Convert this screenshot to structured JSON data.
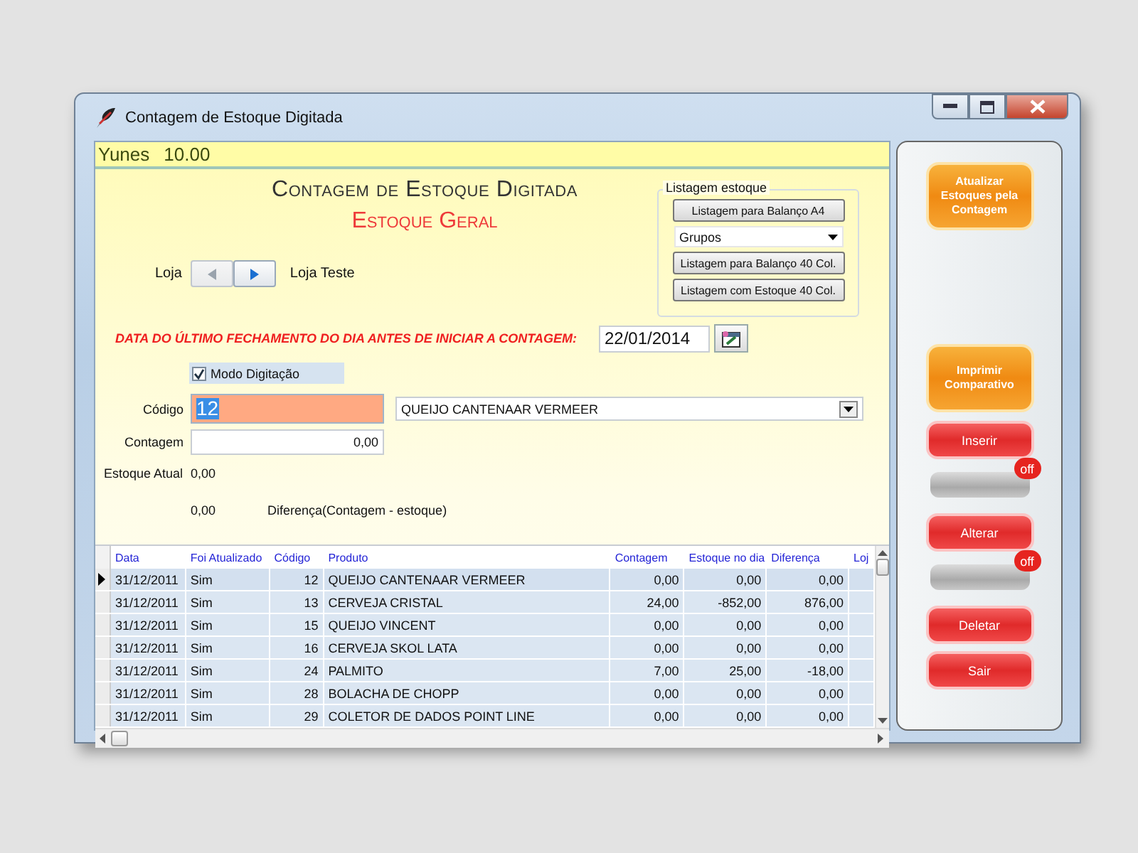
{
  "window": {
    "title": "Contagem de Estoque Digitada"
  },
  "header": {
    "user": "Yunes",
    "version": "10.00"
  },
  "form": {
    "title": "Contagem de Estoque Digitada",
    "subtitle": "Estoque Geral",
    "store": {
      "label": "Loja",
      "name": "Loja Teste",
      "nav": [
        {
          "kind": "prev",
          "disabled": true
        },
        {
          "kind": "next",
          "disabled": false
        }
      ]
    },
    "listing": {
      "title": "Listagem estoque",
      "items": [
        {
          "kind": "button",
          "label": "Listagem para Balanço A4"
        },
        {
          "kind": "select",
          "value": "Grupos"
        },
        {
          "kind": "button",
          "label": "Listagem para Balanço 40 Col."
        },
        {
          "kind": "button",
          "label": "Listagem com Estoque 40 Col."
        }
      ]
    },
    "last_close": {
      "label": "DATA DO ÚLTIMO FECHAMENTO DO DIA ANTES DE INICIAR A CONTAGEM:",
      "value": "22/01/2014"
    },
    "typing_mode": {
      "label": "Modo Digitação",
      "checked": true
    },
    "code": {
      "label": "Código",
      "value": "12",
      "product": "QUEIJO CANTENAAR VERMEER"
    },
    "count": {
      "label": "Contagem",
      "value": "0,00"
    },
    "current_stock": {
      "label": "Estoque Atual",
      "value": "0,00"
    },
    "difference": {
      "value": "0,00",
      "label": "Diferença(Contagem - estoque)"
    }
  },
  "table": {
    "columns": [
      {
        "label": "Data",
        "kind": "text"
      },
      {
        "label": "Foi Atualizado",
        "kind": "text"
      },
      {
        "label": "Código",
        "kind": "number"
      },
      {
        "label": "Produto",
        "kind": "text"
      },
      {
        "label": "Contagem",
        "kind": "number"
      },
      {
        "label": "Estoque no dia",
        "kind": "number"
      },
      {
        "label": "Diferença",
        "kind": "number"
      },
      {
        "label": "Loj",
        "kind": "text"
      }
    ],
    "rows": [
      {
        "selected": true,
        "cells": [
          "31/12/2011",
          "Sim",
          "12",
          "QUEIJO CANTENAAR VERMEER",
          "0,00",
          "0,00",
          "0,00"
        ]
      },
      {
        "selected": false,
        "cells": [
          "31/12/2011",
          "Sim",
          "13",
          "CERVEJA CRISTAL",
          "24,00",
          "-852,00",
          "876,00"
        ]
      },
      {
        "selected": false,
        "cells": [
          "31/12/2011",
          "Sim",
          "15",
          "QUEIJO VINCENT",
          "0,00",
          "0,00",
          "0,00"
        ]
      },
      {
        "selected": false,
        "cells": [
          "31/12/2011",
          "Sim",
          "16",
          "CERVEJA SKOL LATA",
          "0,00",
          "0,00",
          "0,00"
        ]
      },
      {
        "selected": false,
        "cells": [
          "31/12/2011",
          "Sim",
          "24",
          "PALMITO",
          "7,00",
          "25,00",
          "-18,00"
        ]
      },
      {
        "selected": false,
        "cells": [
          "31/12/2011",
          "Sim",
          "28",
          "BOLACHA DE CHOPP",
          "0,00",
          "0,00",
          "0,00"
        ]
      },
      {
        "selected": false,
        "cells": [
          "31/12/2011",
          "Sim",
          "29",
          "COLETOR DE DADOS POINT LINE",
          "0,00",
          "0,00",
          "0,00"
        ]
      }
    ]
  },
  "sidebar": {
    "buttons": [
      {
        "kind": "primary",
        "label": "Atualizar Estoques pela Contagem"
      },
      {
        "kind": "primary",
        "label": "Imprimir Comparativo"
      },
      {
        "kind": "action",
        "label": "Inserir"
      },
      {
        "kind": "toggle",
        "badge": "off",
        "on": false
      },
      {
        "kind": "action",
        "label": "Alterar"
      },
      {
        "kind": "toggle",
        "badge": "off",
        "on": false
      },
      {
        "kind": "action",
        "label": "Deletar"
      },
      {
        "kind": "action",
        "label": "Sair"
      }
    ]
  }
}
